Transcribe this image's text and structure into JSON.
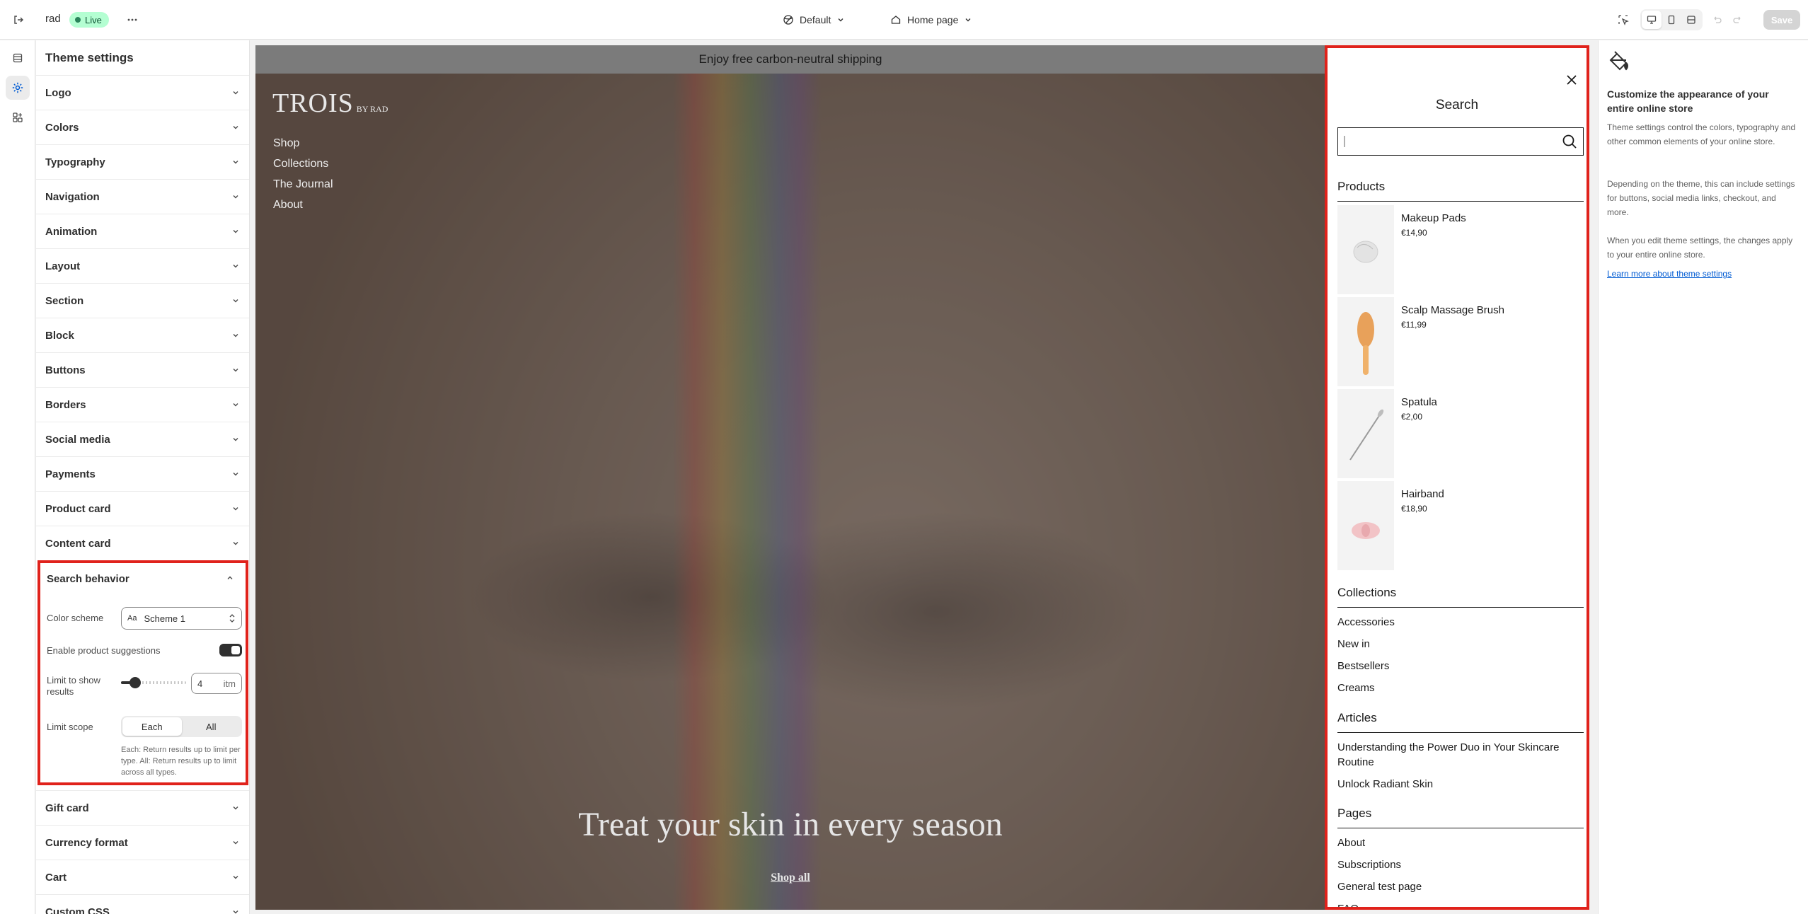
{
  "topbar": {
    "store_name": "rad",
    "status": "Live",
    "theme_select": "Default",
    "page_select": "Home page",
    "save_label": "Save"
  },
  "settings": {
    "title": "Theme settings",
    "sections_top": [
      "Logo",
      "Colors",
      "Typography",
      "Navigation",
      "Animation",
      "Layout",
      "Section",
      "Block",
      "Buttons",
      "Borders",
      "Social media",
      "Payments",
      "Product card",
      "Content card"
    ],
    "search_behavior": {
      "title": "Search behavior",
      "color_scheme_label": "Color scheme",
      "color_scheme_chip": "Aa",
      "color_scheme_value": "Scheme 1",
      "suggestions_label": "Enable product suggestions",
      "suggestions_enabled": true,
      "limit_label": "Limit to show results",
      "limit_value": "4",
      "limit_unit": "itm",
      "limit_slider_fraction": 0.22,
      "scope_label": "Limit scope",
      "scope_options": [
        "Each",
        "All"
      ],
      "scope_selected": "Each",
      "scope_help": "Each: Return results up to limit per type. All: Return results up to limit across all types."
    },
    "sections_bottom": [
      "Gift card",
      "Currency format",
      "Cart",
      "Custom CSS"
    ]
  },
  "preview": {
    "announcement": "Enjoy free carbon-neutral shipping",
    "brand": "TROIS",
    "brand_sub": "BY RAD",
    "nav": [
      "Shop",
      "Collections",
      "The Journal",
      "About"
    ],
    "hero_title": "Treat your skin in every season",
    "hero_link": "Shop all"
  },
  "search_drawer": {
    "title": "Search",
    "products_title": "Products",
    "products": [
      {
        "name": "Makeup Pads",
        "price": "€14,90"
      },
      {
        "name": "Scalp Massage Brush",
        "price": "€11,99"
      },
      {
        "name": "Spatula",
        "price": "€2,00"
      },
      {
        "name": "Hairband",
        "price": "€18,90"
      }
    ],
    "collections_title": "Collections",
    "collections": [
      "Accessories",
      "New in",
      "Bestsellers",
      "Creams"
    ],
    "articles_title": "Articles",
    "articles": [
      "Understanding the Power Duo in Your Skincare Routine",
      "Unlock Radiant Skin"
    ],
    "pages_title": "Pages",
    "pages": [
      "About",
      "Subscriptions",
      "General test page",
      "FAQ"
    ]
  },
  "info_panel": {
    "heading": "Customize the appearance of your entire online store",
    "paragraphs": [
      "Theme settings control the colors, typography and other common elements of your online store.",
      "Depending on the theme, this can include settings for buttons, social media links, checkout, and more.",
      "When you edit theme settings, the changes apply to your entire online store."
    ],
    "link": "Learn more about theme settings"
  },
  "colors": {
    "highlight": "#e0221b",
    "live_badge": "#b4fed2",
    "link": "#005bd3"
  }
}
